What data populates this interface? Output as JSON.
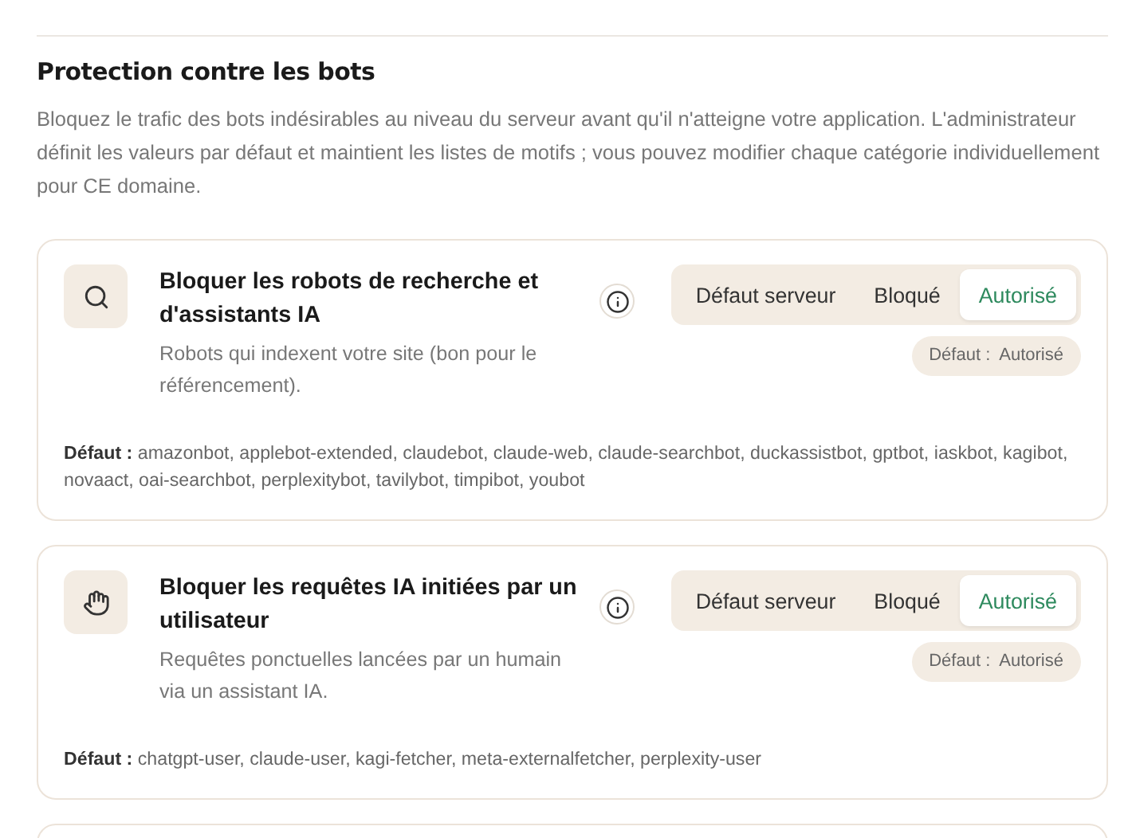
{
  "section": {
    "title": "Protection contre les bots",
    "description": "Bloquez le trafic des bots indésirables au niveau du serveur avant qu'il n'atteigne votre application. L'administrateur définit les valeurs par défaut et maintient les listes de motifs ; vous pouvez modifier chaque catégorie individuellement pour CE domaine."
  },
  "categories": [
    {
      "kind": "search",
      "title": "Bloquer les robots de recherche et d'assistants IA",
      "description": "Robots qui indexent votre site (bon pour le référencement).",
      "options": [
        {
          "label": "Défaut serveur",
          "selected": false
        },
        {
          "label": "Bloqué",
          "selected": false
        },
        {
          "label": "Autorisé",
          "selected": true
        }
      ],
      "default_badge": "Défaut :  Autorisé",
      "defaults": "**Défaut :** amazonbot, applebot-extended, claudebot, claude-web, claude-searchbot, duckassistbot, gptbot, iaskbot, kagibot, novaact, oai-searchbot, perplexitybot, tavilybot, timpibot, youbot"
    },
    {
      "kind": "hand",
      "title": "Bloquer les requêtes IA initiées par un utilisateur",
      "description": "Requêtes ponctuelles lancées par un humain via un assistant IA.",
      "options": [
        {
          "label": "Défaut serveur",
          "selected": false
        },
        {
          "label": "Bloqué",
          "selected": false
        },
        {
          "label": "Autorisé",
          "selected": true
        }
      ],
      "default_badge": "Défaut :  Autorisé",
      "defaults": "**Défaut :** chatgpt-user, claude-user, kagi-fetcher, meta-externalfetcher, perplexity-user"
    }
  ]
}
